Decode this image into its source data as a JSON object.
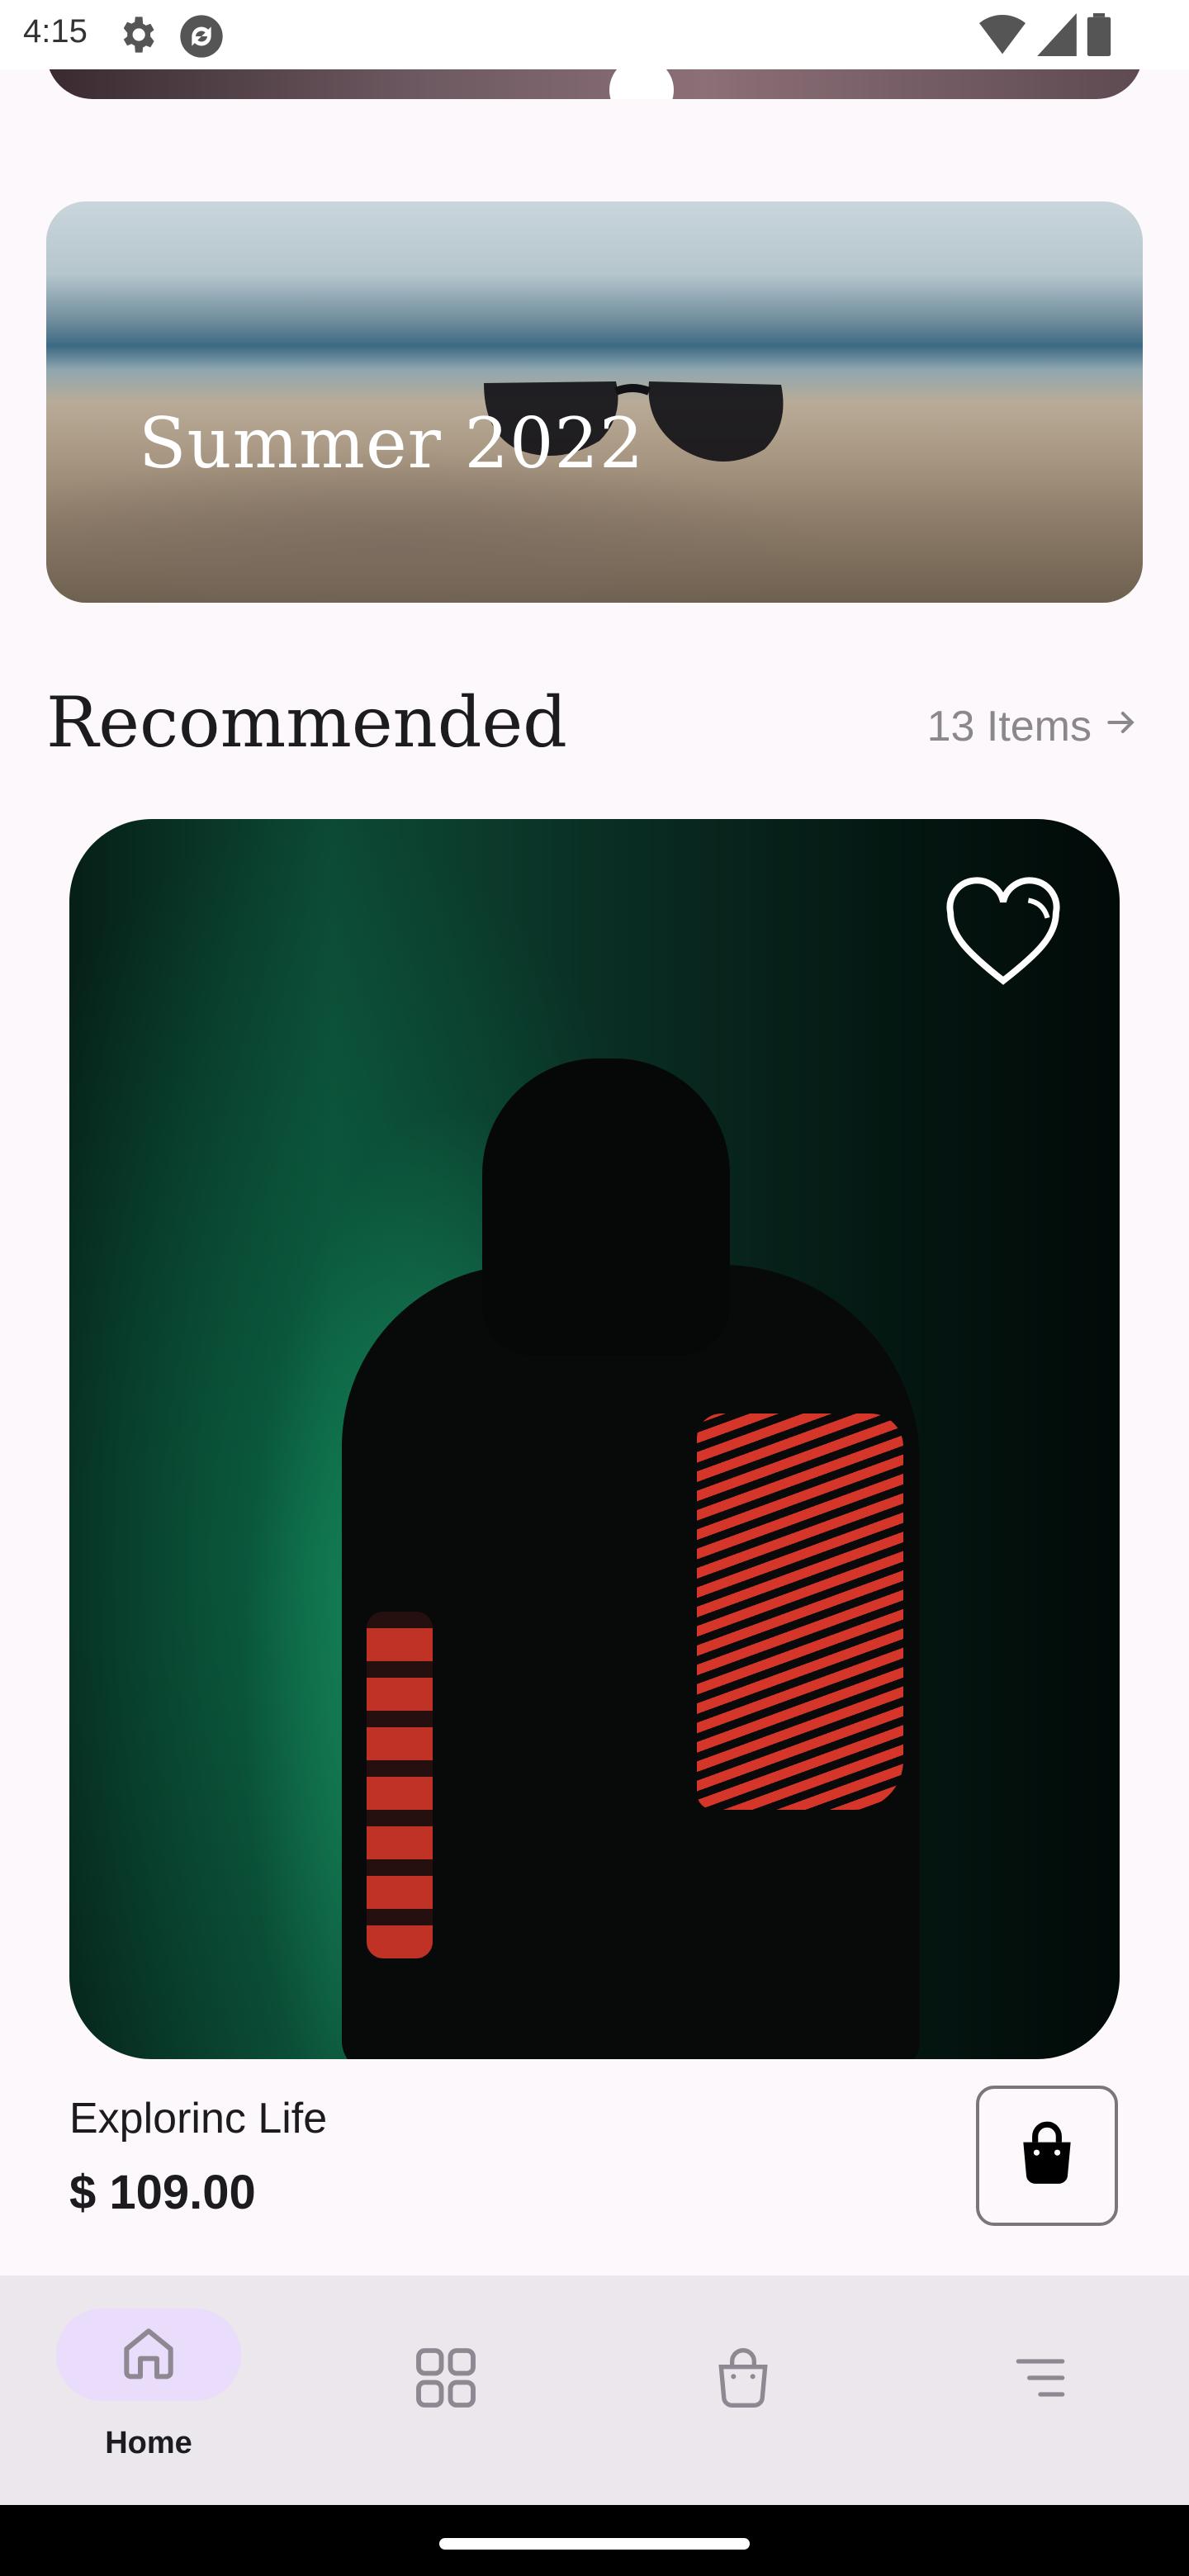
{
  "status_bar": {
    "time": "4:15",
    "icons": [
      "settings-icon",
      "sync-icon",
      "wifi-icon",
      "cellular-icon",
      "battery-icon"
    ]
  },
  "banner": {
    "title": "Summer 2022"
  },
  "recommended": {
    "title": "Recommended",
    "link_label": "13 Items"
  },
  "product": {
    "name": "Explorinc Life",
    "price": "$ 109.00",
    "favorite_icon": "heart-icon",
    "cart_icon": "shopping-bag-icon"
  },
  "bottom_nav": {
    "items": [
      {
        "label": "Home",
        "icon": "home-icon",
        "active": true
      },
      {
        "label": "",
        "icon": "grid-icon",
        "active": false
      },
      {
        "label": "",
        "icon": "bag-icon",
        "active": false
      },
      {
        "label": "",
        "icon": "menu-icon",
        "active": false
      }
    ]
  },
  "colors": {
    "background": "#fdf8fb",
    "nav_background": "#ebe7ec",
    "active_pill": "#eadcfb",
    "text_primary": "#1c1b1f",
    "text_secondary": "#8a878d"
  }
}
